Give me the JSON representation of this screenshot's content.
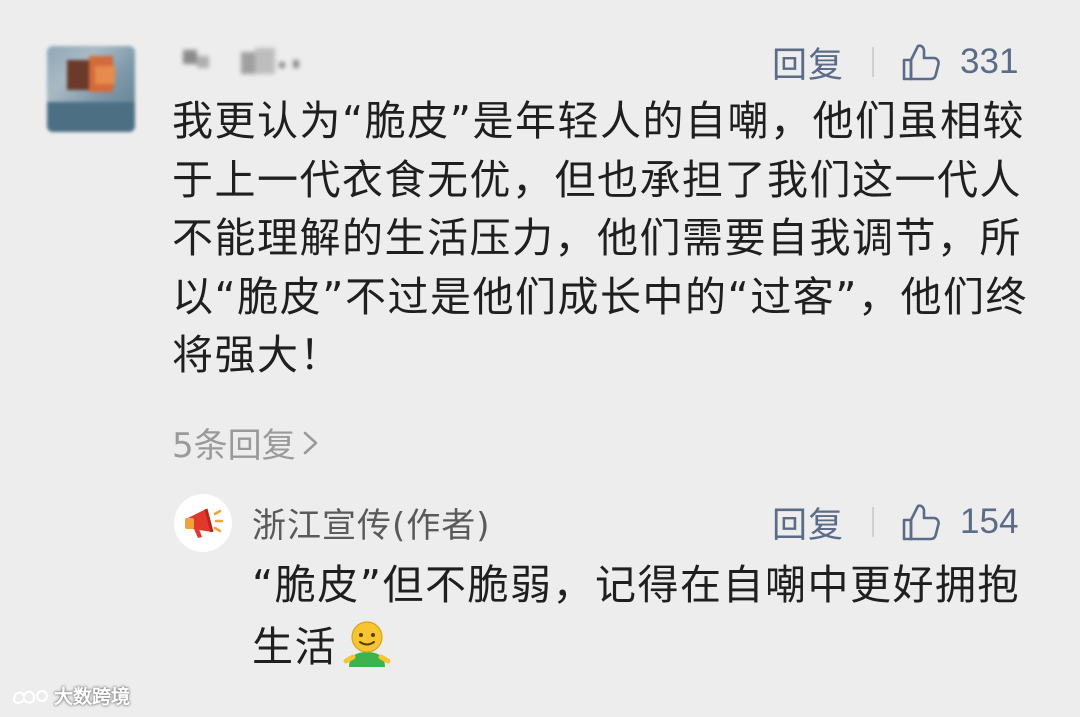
{
  "main_comment": {
    "reply_label": "回复",
    "like_count": "331",
    "text": "我更认为“脆皮”是年轻人的自嘲，他们虽相较于上一代衣食无优，但也承担了我们这一代人不能理解的生活压力，他们需要自我调节，所以“脆皮”不过是他们成长中的“过客”，他们终将强大！",
    "more_replies": "5条回复"
  },
  "reply": {
    "author": "浙江宣传(作者)",
    "reply_label": "回复",
    "like_count": "154",
    "text": "“脆皮”但不脆弱，记得在自嘲中更好拥抱生活"
  },
  "watermark": {
    "text": "大数跨境"
  },
  "colors": {
    "background": "#ededed",
    "action": "#5a6c88",
    "muted": "#9a9a9a",
    "text": "#1f1f1f"
  },
  "icons": {
    "like": "thumbs-up-icon",
    "chevron": "chevron-right-icon",
    "emoji": "smiling-face-emoji",
    "megaphone": "megaphone-icon"
  }
}
